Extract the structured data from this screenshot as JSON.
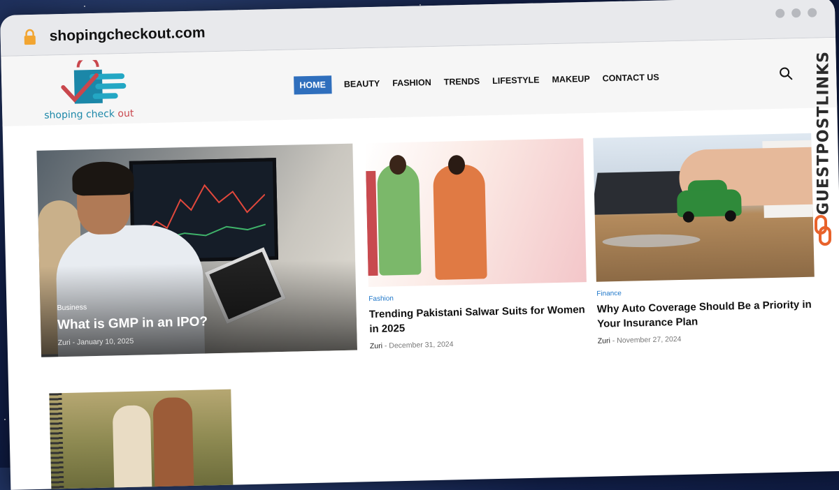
{
  "browser": {
    "url": "shopingcheckout.com"
  },
  "header": {
    "logo_text": "shoping check",
    "logo_text_accent": "out",
    "nav": [
      "HOME",
      "BEAUTY",
      "FASHION",
      "TRENDS",
      "LIFESTYLE",
      "MAKEUP",
      "CONTACT US"
    ]
  },
  "posts": {
    "featured": {
      "category": "Business",
      "title": "What is GMP in an IPO?",
      "author": "Zuri",
      "date": "January 10, 2025"
    },
    "second": {
      "category": "Fashion",
      "title": "Trending Pakistani Salwar Suits for Women in 2025",
      "author": "Zuri",
      "date": "December 31, 2024"
    },
    "third": {
      "category": "Finance",
      "title": "Why Auto Coverage Should Be a Priority in Your Insurance Plan",
      "author": "Zuri",
      "date": "November 27, 2024"
    }
  },
  "watermark": {
    "text": "GUESTPOSTLINKS"
  },
  "icons": {
    "lock": "lock-icon",
    "search": "search-icon",
    "link": "link-icon"
  },
  "colors": {
    "nav_active": "#2f6fbd",
    "category": "#1f77c9",
    "logo_blue": "#1b87a8",
    "logo_red": "#c9474d"
  }
}
